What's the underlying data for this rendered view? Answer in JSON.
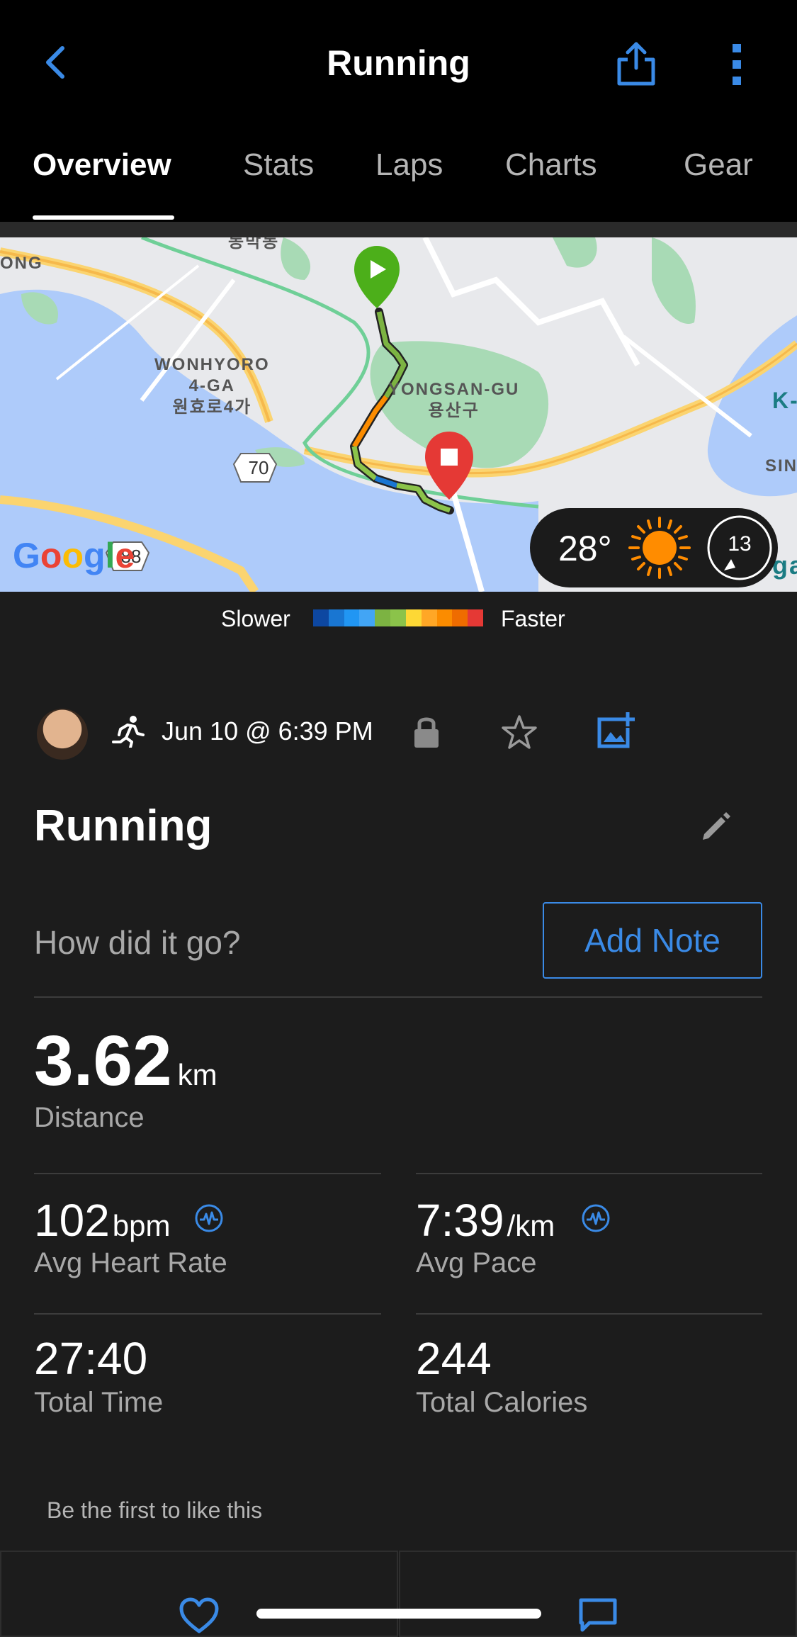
{
  "header": {
    "title": "Running",
    "back_icon": "chevron-left-icon",
    "share_icon": "share-icon",
    "more_icon": "more-vertical-icon"
  },
  "tabs": [
    {
      "label": "Overview",
      "active": true
    },
    {
      "label": "Stats",
      "active": false
    },
    {
      "label": "Laps",
      "active": false
    },
    {
      "label": "Charts",
      "active": false
    },
    {
      "label": "Gear",
      "active": false
    }
  ],
  "map": {
    "labels": {
      "wonhyoro": "WONHYORO\n4-GA\n원효로4가",
      "yongsan": "YONGSAN-GU\n용산구",
      "ong": "ONG",
      "dong": "동막동",
      "k": "K-",
      "sin": "SIN",
      "gar": "gar"
    },
    "shields": {
      "r70": "70",
      "r88": "88"
    },
    "provider": "Google"
  },
  "weather": {
    "temperature": "28°",
    "condition_icon": "sun-icon",
    "wind": "13"
  },
  "legend": {
    "slower": "Slower",
    "faster": "Faster",
    "colors": [
      "#0d47a1",
      "#1976d2",
      "#2196f3",
      "#42a5f5",
      "#7cb342",
      "#8bc34a",
      "#fdd835",
      "#ffa726",
      "#fb8c00",
      "#ef6c00",
      "#e53935"
    ]
  },
  "activity": {
    "date": "Jun 10 @ 6:39 PM",
    "name": "Running",
    "note_prompt": "How did it go?",
    "add_note_label": "Add Note"
  },
  "stats": {
    "distance": {
      "value": "3.62",
      "unit": "km",
      "label": "Distance"
    },
    "heart_rate": {
      "value": "102",
      "unit": "bpm",
      "label": "Avg Heart Rate"
    },
    "pace": {
      "value": "7:39",
      "unit": "/km",
      "label": "Avg Pace"
    },
    "time": {
      "value": "27:40",
      "label": "Total Time"
    },
    "calories": {
      "value": "244",
      "label": "Total Calories"
    }
  },
  "social": {
    "likes_text": "Be the first to like this"
  },
  "colors": {
    "accent": "#3a8ae6",
    "background": "#1c1c1c"
  }
}
